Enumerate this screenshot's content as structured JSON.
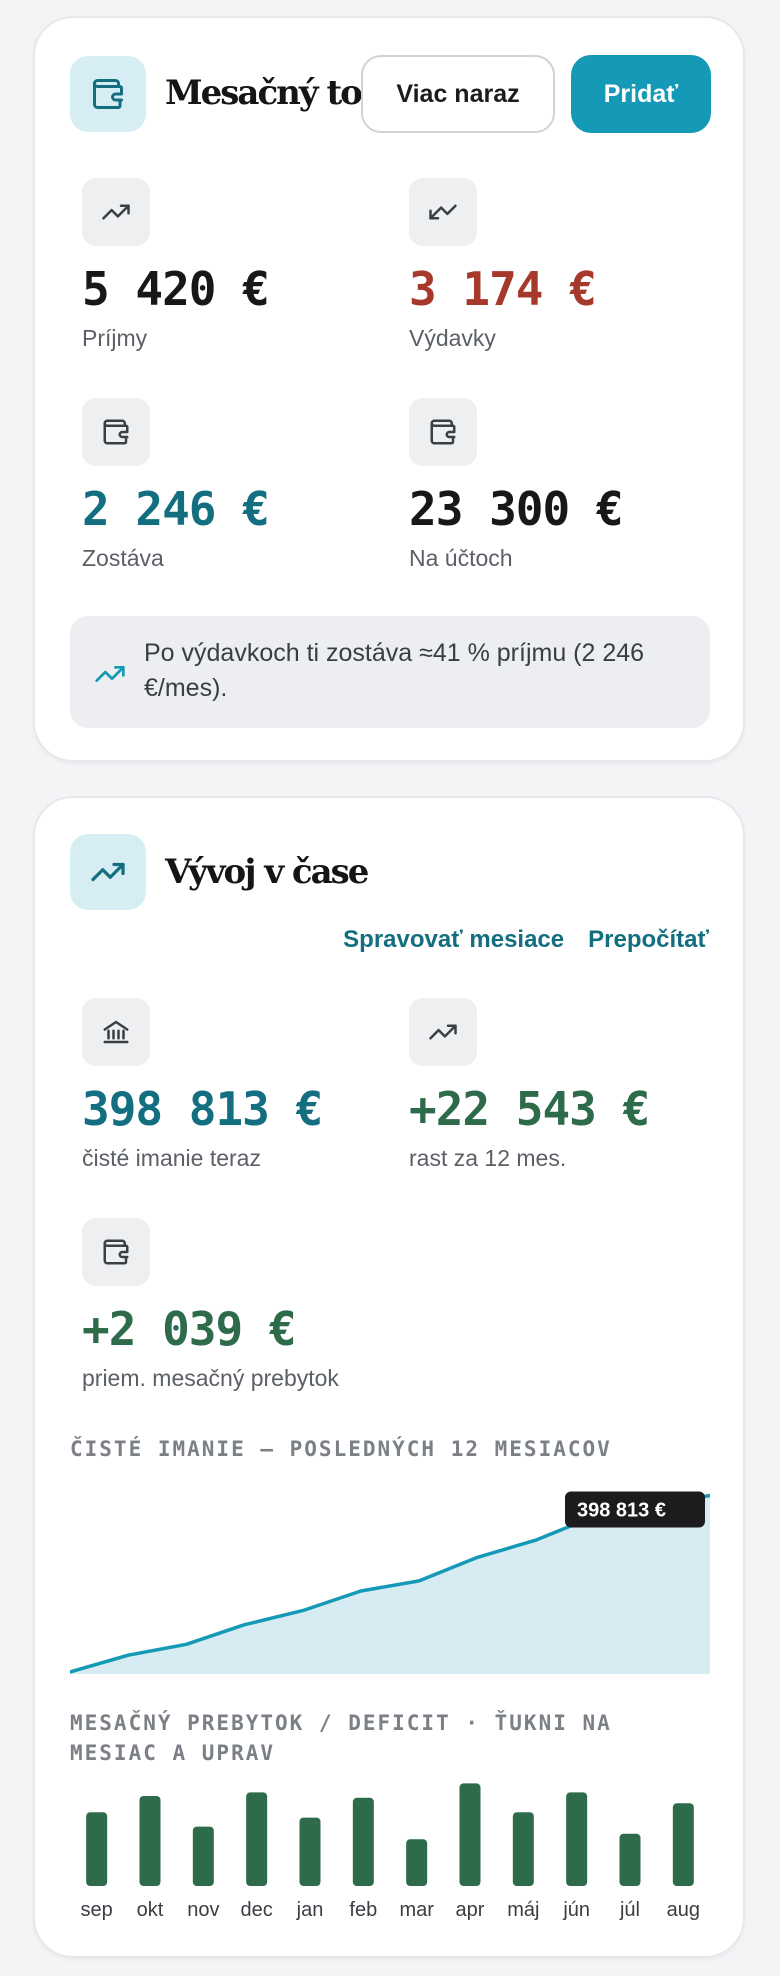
{
  "flow": {
    "title": "Mesačný tok",
    "icon": "wallet-icon",
    "btn_bulk": "Viac naraz",
    "btn_add": "Pridať",
    "stats": [
      {
        "value": "5 420 €",
        "label": "Príjmy",
        "icon": "trending-up-icon"
      },
      {
        "value": "3 174 €",
        "label": "Výdavky",
        "icon": "trending-down-icon"
      },
      {
        "value": "2 246 €",
        "label": "Zostáva",
        "icon": "wallet-icon"
      },
      {
        "value": "23 300 €",
        "label": "Na účtoch",
        "icon": "wallet-icon"
      }
    ],
    "info": "Po výdavkoch ti zostáva ≈41 % príjmu (2 246 €/mes)."
  },
  "trend": {
    "title": "Vývoj v čase",
    "icon": "trending-up-icon",
    "link_manage": "Spravovať mesiace",
    "link_recalc": "Prepočítať",
    "stats": [
      {
        "value": "398 813 €",
        "label": "čisté imanie teraz",
        "icon": "bank-icon"
      },
      {
        "value": "+22 543 €",
        "label": "rast za 12 mes.",
        "icon": "trending-up-icon"
      },
      {
        "value": "+2 039 €",
        "label": "priem. mesačný prebytok",
        "icon": "wallet-icon"
      }
    ],
    "net_worth_title": "ČISTÉ IMANIE — POSLEDNÝCH 12 MESIACOV",
    "surplus_title": "MESAČNÝ PREBYTOK / DEFICIT · ŤUKNI NA MESIAC A UPRAV",
    "tooltip": "398 813 €"
  },
  "colors": {
    "accent": "#1499b6",
    "teal_text": "#136f80",
    "red": "#a7392c",
    "green": "#2e6b4b",
    "area_fill": "#d6ecf2"
  },
  "chart_data": [
    {
      "type": "area",
      "title": "ČISTÉ IMANIE — POSLEDNÝCH 12 MESIACOV",
      "x": [
        "sep",
        "okt",
        "nov",
        "dec",
        "jan",
        "feb",
        "mar",
        "apr",
        "máj",
        "jún",
        "júl",
        "aug"
      ],
      "values": [
        376270,
        378400,
        379800,
        382300,
        384100,
        386600,
        387900,
        390900,
        393100,
        396100,
        397500,
        398813
      ],
      "ylim": [
        376000,
        399000
      ],
      "grid": false,
      "annotation": "398 813 €"
    },
    {
      "type": "bar",
      "title": "MESAČNÝ PREBYTOK / DEFICIT · ŤUKNI NA MESIAC A UPRAV",
      "categories": [
        "sep",
        "okt",
        "nov",
        "dec",
        "jan",
        "feb",
        "mar",
        "apr",
        "máj",
        "jún",
        "júl",
        "aug"
      ],
      "values": [
        2050,
        2500,
        1650,
        2600,
        1900,
        2450,
        1300,
        2850,
        2050,
        2600,
        1450,
        2300
      ],
      "ylim": [
        0,
        3000
      ]
    }
  ]
}
